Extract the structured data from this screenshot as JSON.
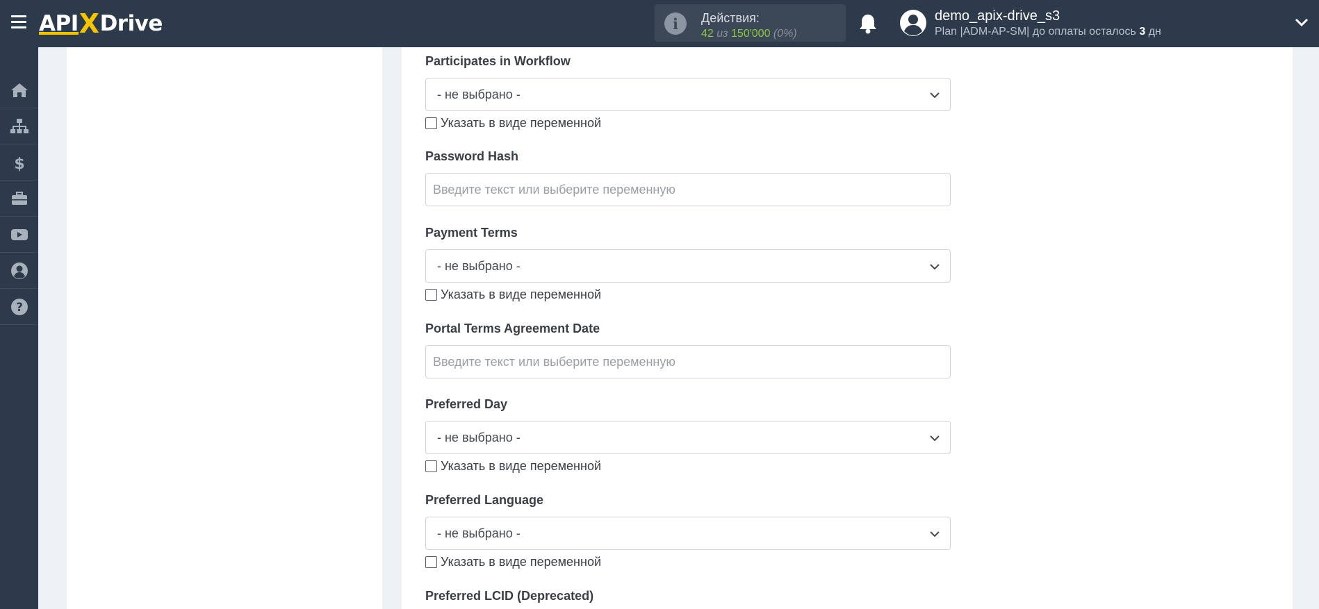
{
  "header": {
    "logo_part1": "API",
    "logo_x": "X",
    "logo_part2": "Drive",
    "actions_title": "Действия:",
    "actions_used": "42",
    "actions_of": " из ",
    "actions_total": "150'000",
    "actions_percent": " (0%)",
    "user_name": "demo_apix-drive_s3",
    "plan_prefix": "Plan |ADM-AP-SM| до оплаты осталось ",
    "plan_days": "3",
    "plan_suffix": " дн"
  },
  "sidebar": {
    "items": [
      "home-icon",
      "sitemap-icon",
      "dollar-icon",
      "briefcase-icon",
      "youtube-icon",
      "user-circle-icon",
      "question-circle-icon"
    ]
  },
  "form": {
    "checkbox_label": "Указать в виде переменной",
    "select_default": "- не выбрано -",
    "input_placeholder": "Введите текст или выберите переменную",
    "fields": [
      {
        "label": "Participates in Workflow",
        "type": "select"
      },
      {
        "label": "Password Hash",
        "type": "text"
      },
      {
        "label": "Payment Terms",
        "type": "select"
      },
      {
        "label": "Portal Terms Agreement Date",
        "type": "text"
      },
      {
        "label": "Preferred Day",
        "type": "select"
      },
      {
        "label": "Preferred Language",
        "type": "select"
      },
      {
        "label": "Preferred LCID (Deprecated)",
        "type": "select"
      }
    ]
  },
  "colors": {
    "topbar": "#2d3a4b",
    "accent_yellow": "#f2c500",
    "actions_green": "#8cc63f"
  }
}
